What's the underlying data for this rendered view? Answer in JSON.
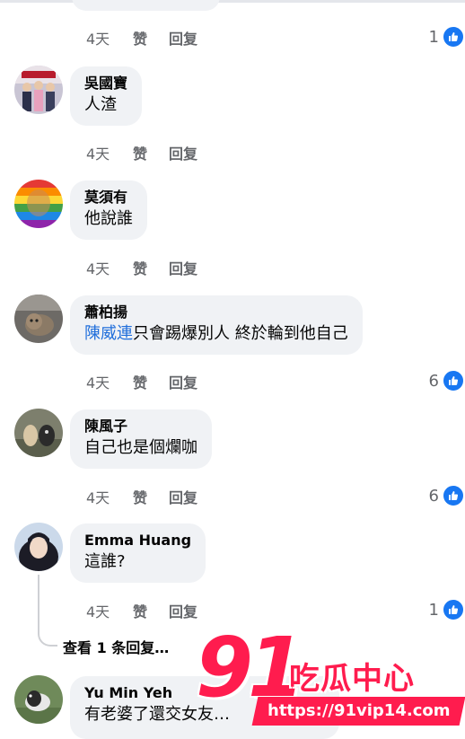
{
  "colors": {
    "like_blue": "#1877f2",
    "mention_blue": "#216fdb",
    "bubble_bg": "#f0f2f5",
    "meta_gray": "#65676b",
    "watermark_red": "#ff1c4e"
  },
  "first_actions": {
    "time": "4天",
    "like": "赞",
    "reply": "回复",
    "reactions": "1"
  },
  "comments": [
    {
      "name": "吳國寶",
      "text": "人渣",
      "time": "4天",
      "like": "赞",
      "reply": "回复"
    },
    {
      "name": "莫須有",
      "text": "他說誰",
      "time": "4天",
      "like": "赞",
      "reply": "回复"
    },
    {
      "name": "蕭柏揚",
      "mention": "陳威連",
      "text": "只會踢爆別人 終於輪到他自己",
      "time": "4天",
      "like": "赞",
      "reply": "回复",
      "reactions": "6"
    },
    {
      "name": "陳風子",
      "text": "自己也是個爛咖",
      "time": "4天",
      "like": "赞",
      "reply": "回复",
      "reactions": "6"
    },
    {
      "name": "Emma Huang",
      "text": "這誰?",
      "time": "4天",
      "like": "赞",
      "reply": "回复",
      "reactions": "1"
    },
    {
      "name": "Yu Min Yeh",
      "text": "有老婆了還交女友…"
    }
  ],
  "view_replies": "查看 1 条回复…",
  "watermark": {
    "number": "91",
    "brand": "吃瓜中心",
    "url": "https://91vip14.com"
  },
  "icons": {
    "reaction": "thumbs-up-icon"
  }
}
